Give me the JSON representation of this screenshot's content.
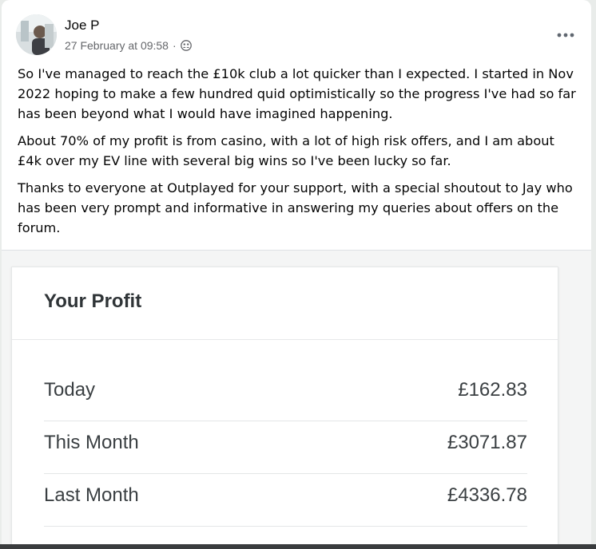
{
  "post": {
    "author": "Joe P",
    "timestamp": "27 February at 09:58",
    "separator": "·",
    "audience_icon": "people-icon",
    "more_icon": "more-options-icon",
    "paragraphs": [
      "So I've managed to reach the £10k club a lot quicker than I expected. I started in Nov 2022 hoping to make a few hundred quid optimistically so the progress I've had so far has been beyond what I would have imagined happening.",
      "About 70% of my profit is from casino, with a lot of high risk offers, and I am about £4k over my EV line with several big wins so I've been lucky so far.",
      "Thanks to everyone at Outplayed for your support, with a special shoutout to Jay who has been very prompt and informative in answering my queries about offers on the forum."
    ]
  },
  "profit_card": {
    "title": "Your Profit",
    "rows": [
      {
        "label": "Today",
        "value": "£162.83"
      },
      {
        "label": "This Month",
        "value": "£3071.87"
      },
      {
        "label": "Last Month",
        "value": "£4336.78"
      }
    ]
  },
  "colors": {
    "text_primary": "#050505",
    "text_secondary": "#65676b",
    "card_text": "#3a3f42"
  }
}
